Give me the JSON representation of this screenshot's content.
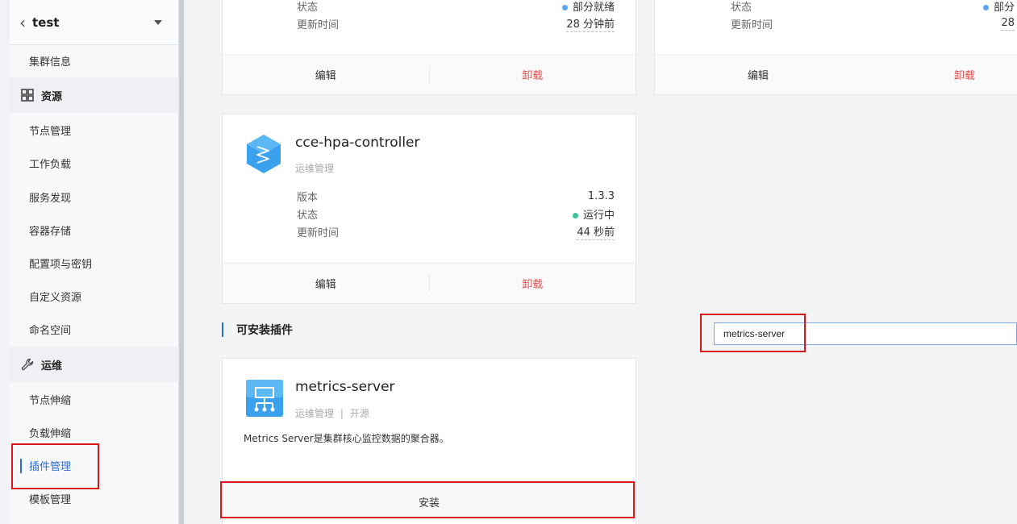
{
  "sidebar": {
    "title": "test",
    "items": [
      {
        "label": "集群信息"
      },
      {
        "label": "资源",
        "group": true
      },
      {
        "label": "节点管理"
      },
      {
        "label": "工作负载"
      },
      {
        "label": "服务发现"
      },
      {
        "label": "容器存储"
      },
      {
        "label": "配置项与密钥"
      },
      {
        "label": "自定义资源"
      },
      {
        "label": "命名空间"
      },
      {
        "label": "运维",
        "group": true
      },
      {
        "label": "节点伸缩"
      },
      {
        "label": "负载伸缩"
      },
      {
        "label": "插件管理",
        "active": true
      },
      {
        "label": "模板管理"
      }
    ]
  },
  "cards": {
    "top_left": {
      "status_label": "状态",
      "status_value": "部分就绪",
      "updated_label": "更新时间",
      "updated_value": "28 分钟前",
      "edit": "编辑",
      "uninstall": "卸载"
    },
    "top_right": {
      "status_label": "状态",
      "status_value": "部分",
      "updated_label": "更新时间",
      "updated_value": "28",
      "edit": "编辑",
      "uninstall": "卸载"
    },
    "hpa": {
      "name": "cce-hpa-controller",
      "category": "运维管理",
      "version_label": "版本",
      "version_value": "1.3.3",
      "status_label": "状态",
      "status_value": "运行中",
      "updated_label": "更新时间",
      "updated_value": "44 秒前",
      "edit": "编辑",
      "uninstall": "卸载"
    }
  },
  "installable": {
    "title": "可安装插件",
    "search_value": "metrics-server",
    "card": {
      "name": "metrics-server",
      "category": "运维管理",
      "license": "开源",
      "separator": "|",
      "description": "Metrics Server是集群核心监控数据的聚合器。",
      "install": "安装"
    }
  },
  "colors": {
    "status_partial": "#5aa7f0",
    "status_running": "#37c49a",
    "accent": "#2b6fd6",
    "danger": "#e34d4d",
    "highlight_box": "#d9161a"
  }
}
